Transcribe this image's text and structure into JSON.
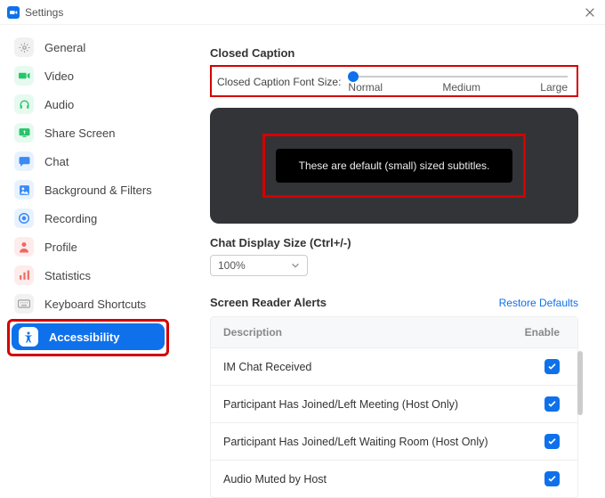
{
  "window": {
    "title": "Settings"
  },
  "sidebar": {
    "items": [
      {
        "label": "General"
      },
      {
        "label": "Video"
      },
      {
        "label": "Audio"
      },
      {
        "label": "Share Screen"
      },
      {
        "label": "Chat"
      },
      {
        "label": "Background & Filters"
      },
      {
        "label": "Recording"
      },
      {
        "label": "Profile"
      },
      {
        "label": "Statistics"
      },
      {
        "label": "Keyboard Shortcuts"
      },
      {
        "label": "Accessibility"
      }
    ]
  },
  "closed_caption": {
    "heading": "Closed Caption",
    "label": "Closed Caption Font Size:",
    "ticks": {
      "normal": "Normal",
      "medium": "Medium",
      "large": "Large"
    },
    "preview_text": "These are default (small) sized subtitles."
  },
  "chat_size": {
    "heading": "Chat Display Size (Ctrl+/-)",
    "value": "100%"
  },
  "alerts": {
    "heading": "Screen Reader Alerts",
    "restore": "Restore Defaults",
    "cols": {
      "desc": "Description",
      "enable": "Enable"
    },
    "rows": [
      {
        "desc": "IM Chat Received"
      },
      {
        "desc": "Participant Has Joined/Left Meeting (Host Only)"
      },
      {
        "desc": "Participant Has Joined/Left Waiting Room (Host Only)"
      },
      {
        "desc": "Audio Muted by Host"
      }
    ]
  }
}
